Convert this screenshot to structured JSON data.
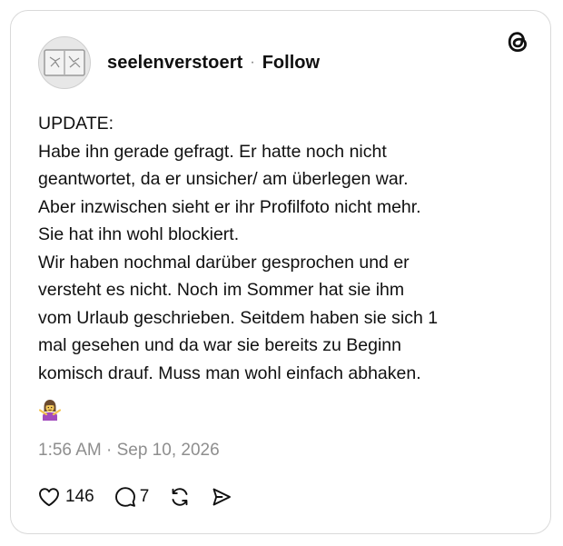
{
  "post": {
    "username": "seelenverstoert",
    "separator": "·",
    "follow_label": "Follow",
    "text": "UPDATE:\nHabe ihn gerade gefragt. Er hatte noch nicht\ngeantwortet, da er unsicher/ am überlegen war.\nAber inzwischen sieht er ihr Profilfoto nicht mehr.\nSie hat ihn wohl blockiert.\nWir haben nochmal darüber gesprochen und er\nversteht es nicht. Noch im Sommer hat sie ihm\nvom Urlaub geschrieben. Seitdem haben sie sich 1\nmal gesehen und da war sie bereits zu Beginn\nkomisch drauf. Muss man wohl einfach abhaken.",
    "emoji": "person-shrugging-emoji",
    "timestamp": "1:56 AM · Sep 10, 2026",
    "likes": "146",
    "replies": "7"
  },
  "icons": {
    "logo": "threads-logo-icon",
    "like": "heart-icon",
    "reply": "comment-icon",
    "repost": "repost-icon",
    "share": "send-icon"
  },
  "colors": {
    "text": "#101010",
    "muted": "#8e8e8e",
    "border": "#d9d9d9",
    "emoji_shirt": "#a24bbd"
  }
}
